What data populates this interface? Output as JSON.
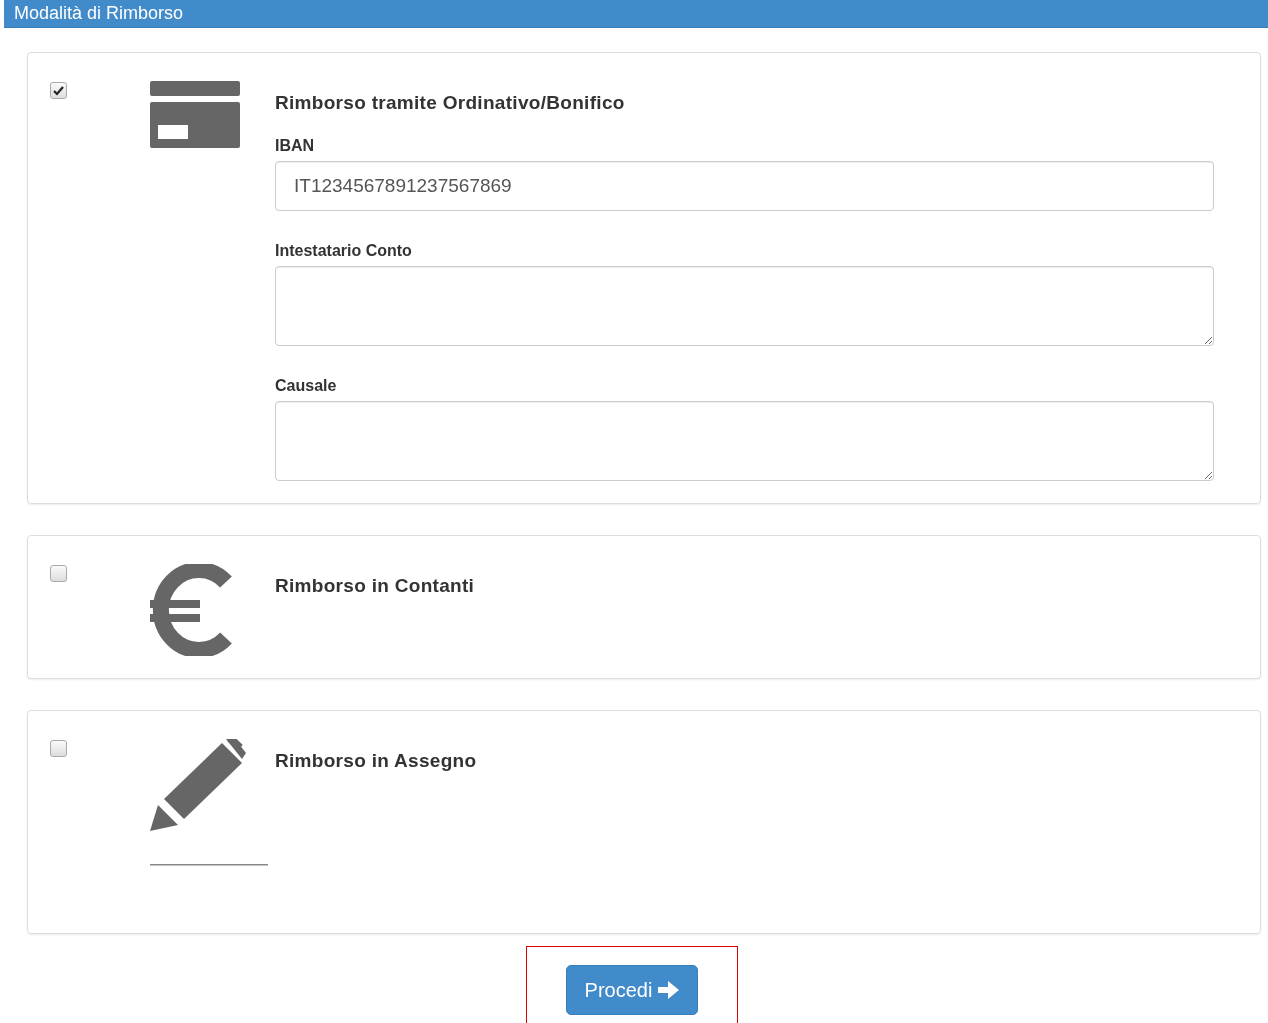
{
  "header": {
    "title": "Modalità di Rimborso"
  },
  "options": [
    {
      "kind": "card",
      "checked": true,
      "title": "Rimborso tramite Ordinativo/Bonifico",
      "fields": [
        {
          "kind": "input",
          "label": "IBAN",
          "value": "IT1234567891237567869"
        },
        {
          "kind": "textarea",
          "label": "Intestatario Conto"
        },
        {
          "kind": "textarea",
          "label": "Causale"
        }
      ]
    },
    {
      "kind": "euro",
      "checked": false,
      "title": "Rimborso in Contanti"
    },
    {
      "kind": "pencil",
      "checked": false,
      "title": "Rimborso in Assegno"
    }
  ],
  "button": {
    "label": "Procedi",
    "highlighted": true
  }
}
